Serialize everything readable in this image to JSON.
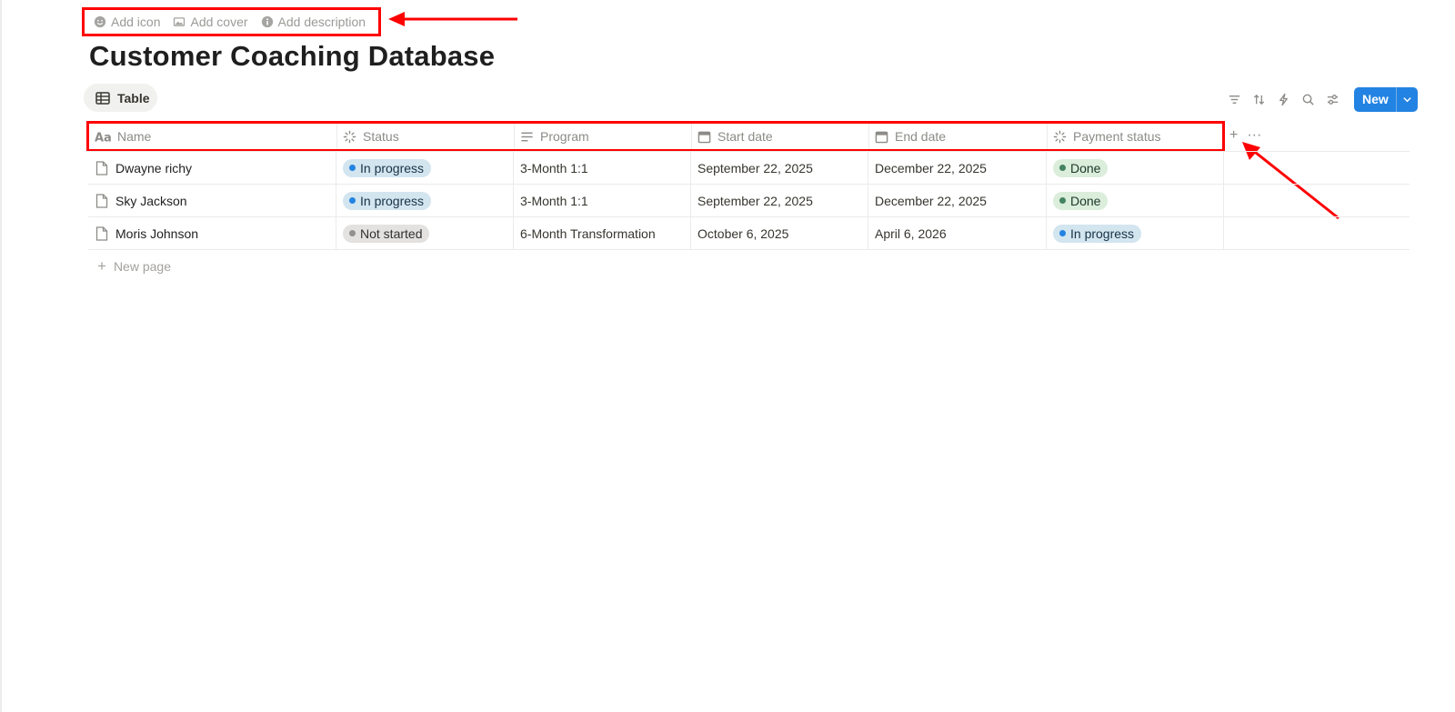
{
  "page": {
    "title": "Customer Coaching Database",
    "meta_actions": [
      {
        "label": "Add icon",
        "icon": "smiley-icon"
      },
      {
        "label": "Add cover",
        "icon": "image-icon"
      },
      {
        "label": "Add description",
        "icon": "info-icon"
      }
    ]
  },
  "view": {
    "tab_label": "Table",
    "icon": "table-icon"
  },
  "toolbar": {
    "tools": [
      "filter-icon",
      "sort-icon",
      "automation-icon",
      "search-icon",
      "view-settings-icon"
    ],
    "new_label": "New",
    "accent": "#2383e2"
  },
  "table": {
    "columns": [
      {
        "label": "Name",
        "icon": "text-type-icon"
      },
      {
        "label": "Status",
        "icon": "status-icon"
      },
      {
        "label": "Program",
        "icon": "text-lines-icon"
      },
      {
        "label": "Start date",
        "icon": "calendar-icon"
      },
      {
        "label": "End date",
        "icon": "calendar-icon"
      },
      {
        "label": "Payment status",
        "icon": "status-icon"
      }
    ],
    "rows": [
      {
        "name": "Dwayne richy",
        "status": "In progress",
        "program": "3-Month 1:1",
        "start": "September 22, 2025",
        "end": "December 22, 2025",
        "payment": "Done"
      },
      {
        "name": "Sky Jackson",
        "status": "In progress",
        "program": "3-Month 1:1",
        "start": "September 22, 2025",
        "end": "December 22, 2025",
        "payment": "Done"
      },
      {
        "name": "Moris Johnson",
        "status": "Not started",
        "program": "6-Month Transformation",
        "start": "October 6, 2025",
        "end": "April 6, 2026",
        "payment": "In progress"
      }
    ],
    "new_page_label": "New page",
    "status_colors": {
      "In progress": {
        "bg": "#d3e5ef",
        "dot": "#2383e2",
        "text": "#183347"
      },
      "Not started": {
        "bg": "#e3e2e0",
        "dot": "#91918e",
        "text": "#32302c"
      },
      "Done": {
        "bg": "#dbeddb",
        "dot": "#448361",
        "text": "#1c3829"
      }
    }
  },
  "annotations": {
    "highlight_color": "#ff0000"
  }
}
